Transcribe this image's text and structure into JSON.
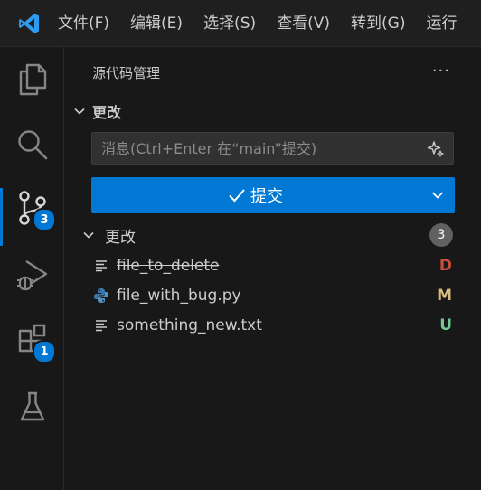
{
  "menu": {
    "items": [
      "文件(F)",
      "编辑(E)",
      "选择(S)",
      "查看(V)",
      "转到(G)",
      "运行"
    ]
  },
  "activity": {
    "scm_badge": "3",
    "extensions_badge": "1"
  },
  "sidebar": {
    "title": "源代码管理",
    "more_label": "···",
    "section_title": "更改",
    "message_placeholder": "消息(Ctrl+Enter 在“main”提交)",
    "commit_label": "提交",
    "group_title": "更改",
    "group_count": "3",
    "files": [
      {
        "name": "file_to_delete",
        "status": "D",
        "status_color": "#c74e39",
        "icon": "text-file-icon"
      },
      {
        "name": "file_with_bug.py",
        "status": "M",
        "status_color": "#d7ba7d",
        "icon": "python-file-icon"
      },
      {
        "name": "something_new.txt",
        "status": "U",
        "status_color": "#73c991",
        "icon": "text-file-icon"
      }
    ]
  },
  "colors": {
    "accent": "#0078d4",
    "background": "#181818"
  }
}
